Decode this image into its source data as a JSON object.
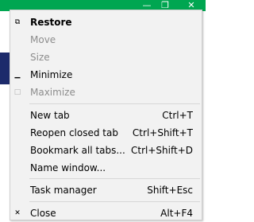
{
  "menu": {
    "groups": [
      {
        "items": [
          {
            "icon": "restore-glyph-icon",
            "label": "Restore",
            "accel": "",
            "bold": true,
            "disabled": false
          },
          {
            "icon": "",
            "label": "Move",
            "accel": "",
            "bold": false,
            "disabled": true
          },
          {
            "icon": "",
            "label": "Size",
            "accel": "",
            "bold": false,
            "disabled": true
          },
          {
            "icon": "minimize-glyph-icon",
            "label": "Minimize",
            "accel": "",
            "bold": false,
            "disabled": false
          },
          {
            "icon": "maximize-glyph-icon",
            "label": "Maximize",
            "accel": "",
            "bold": false,
            "disabled": true
          }
        ]
      },
      {
        "items": [
          {
            "icon": "",
            "label": "New tab",
            "accel": "Ctrl+T",
            "bold": false,
            "disabled": false
          },
          {
            "icon": "",
            "label": "Reopen closed tab",
            "accel": "Ctrl+Shift+T",
            "bold": false,
            "disabled": false
          },
          {
            "icon": "",
            "label": "Bookmark all tabs...",
            "accel": "Ctrl+Shift+D",
            "bold": false,
            "disabled": false
          },
          {
            "icon": "",
            "label": "Name window...",
            "accel": "",
            "bold": false,
            "disabled": false
          }
        ]
      },
      {
        "items": [
          {
            "icon": "",
            "label": "Task manager",
            "accel": "Shift+Esc",
            "bold": false,
            "disabled": false
          }
        ]
      },
      {
        "items": [
          {
            "icon": "close-glyph-icon",
            "label": "Close",
            "accel": "Alt+F4",
            "bold": false,
            "disabled": false
          }
        ]
      }
    ]
  },
  "window": {
    "caption_minimize_icon": "minimize-icon",
    "caption_maximize_icon": "maximize-icon",
    "caption_close_icon": "close-icon"
  },
  "colors": {
    "titlebar": "#00a651",
    "menu_bg": "#f2f2f2",
    "disabled_text": "#8d8d8d"
  }
}
